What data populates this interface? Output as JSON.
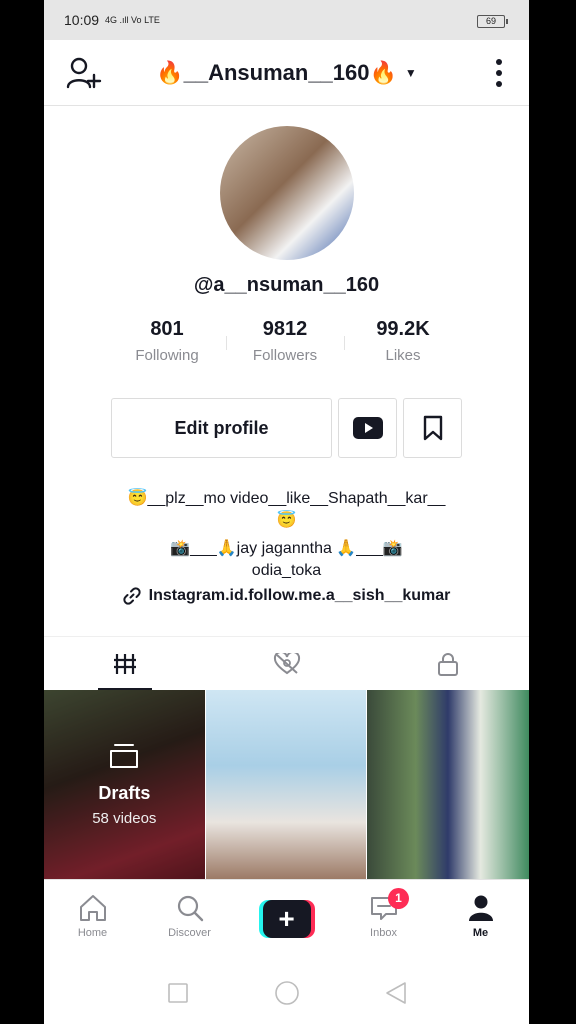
{
  "status_bar": {
    "time": "10:09",
    "signal_text": "4G .ıll Vo LTE",
    "battery": "69"
  },
  "header": {
    "title": "🔥__Ansuman__160🔥"
  },
  "profile": {
    "handle": "@a__nsuman__160",
    "stats": [
      {
        "value": "801",
        "label": "Following"
      },
      {
        "value": "9812",
        "label": "Followers"
      },
      {
        "value": "99.2K",
        "label": "Likes"
      }
    ],
    "edit_button": "Edit profile",
    "bio_lines": [
      "😇__plz__mo video__like__Shapath__kar__",
      "😇",
      "📸___🙏jay jaganntha 🙏___📸",
      "odia_toka"
    ],
    "link": "Instagram.id.follow.me.a__sish__kumar"
  },
  "grid": {
    "drafts_label": "Drafts",
    "drafts_count": "58 videos"
  },
  "bottom_nav": [
    {
      "label": "Home"
    },
    {
      "label": "Discover"
    },
    {
      "label": ""
    },
    {
      "label": "Inbox",
      "badge": "1"
    },
    {
      "label": "Me"
    }
  ],
  "colors": {
    "accent_red": "#fe2c55",
    "accent_cyan": "#25f4ee",
    "text_primary": "#161823",
    "text_secondary": "#8a8b91"
  }
}
